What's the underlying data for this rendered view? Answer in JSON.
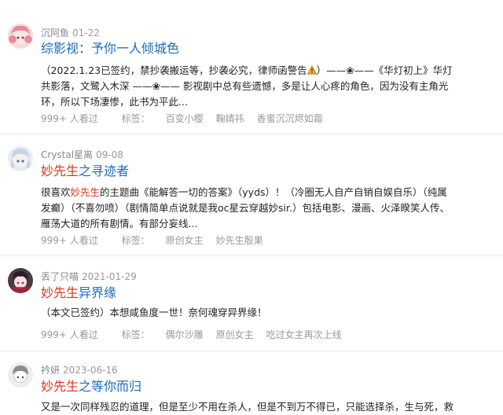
{
  "items": [
    {
      "author": "沉阿鱼",
      "date": "01-22",
      "title_prefix": "",
      "title_rest": "综影视：予你一人倾城色",
      "summary_a": "（2022.1.23已签约，禁抄袭搬运等，抄袭必究，律师函警告",
      "summary_hl": "",
      "summary_b": "）——❀——《华灯初上》华灯共影落，文鹭入木深 ——❀—— 影视剧中总有些遗憾，多是让人心疼的角色，因为没有主角光环，所以下场凄惨，此书为平此...",
      "views": "999+ 人看过",
      "tags_label": "标签：",
      "tags": [
        "百变小樱",
        "鞠婧祎",
        "香蜜沉沉烬如霜"
      ],
      "avatar_icon": "pink-hair-anime-avatar-icon"
    },
    {
      "author": "Crystal星离",
      "date": "09-08",
      "title_prefix": "妙先生",
      "title_rest": "之寻迹者",
      "summary_a": "很喜欢",
      "summary_hl": "妙先生",
      "summary_b": "的主题曲《能解答一切的答案》（yyds）！（冷圈无人自产自销自娱自乐）（纯属发癫）（不喜勿喷）（剧情简单点说就是我oc星云穿越妙sir.）包括电影、漫画、火泽睽笑人传、雁荡大道的所有剧情。有部分妄线...",
      "views": "999+ 人看过",
      "tags_label": "标签：",
      "tags": [
        "原创女主",
        "妙先生殷果"
      ],
      "avatar_icon": "silver-hair-anime-avatar-icon"
    },
    {
      "author": "丢了只喵",
      "date": "2021-01-29",
      "title_prefix": "妙先生",
      "title_rest": "异界缘",
      "summary_a": "（本文已签约）本想咸鱼度一世！奈何魂穿异界缘！",
      "summary_hl": "",
      "summary_b": "",
      "views": "999+ 人看过",
      "tags_label": "标签：",
      "tags": [
        "偶尔沙雕",
        "原创女主",
        "吃过女主再次上线"
      ],
      "avatar_icon": "dark-anime-avatar-icon"
    },
    {
      "author": "衿妍",
      "date": "2023-06-16",
      "title_prefix": "妙先生",
      "title_rest": "之等你而归",
      "summary_a": "又是一次同样残忍的道理，但是至少不用在杀人，但是不到万不得已，只能选择杀，生与死，救",
      "summary_hl": "",
      "summary_b": "",
      "views": "",
      "tags_label": "",
      "tags": [],
      "avatar_icon": "sketch-anime-avatar-icon"
    }
  ],
  "colors": {
    "title": "#1a6bbd",
    "highlight": "#e0301e",
    "meta": "#999999"
  }
}
